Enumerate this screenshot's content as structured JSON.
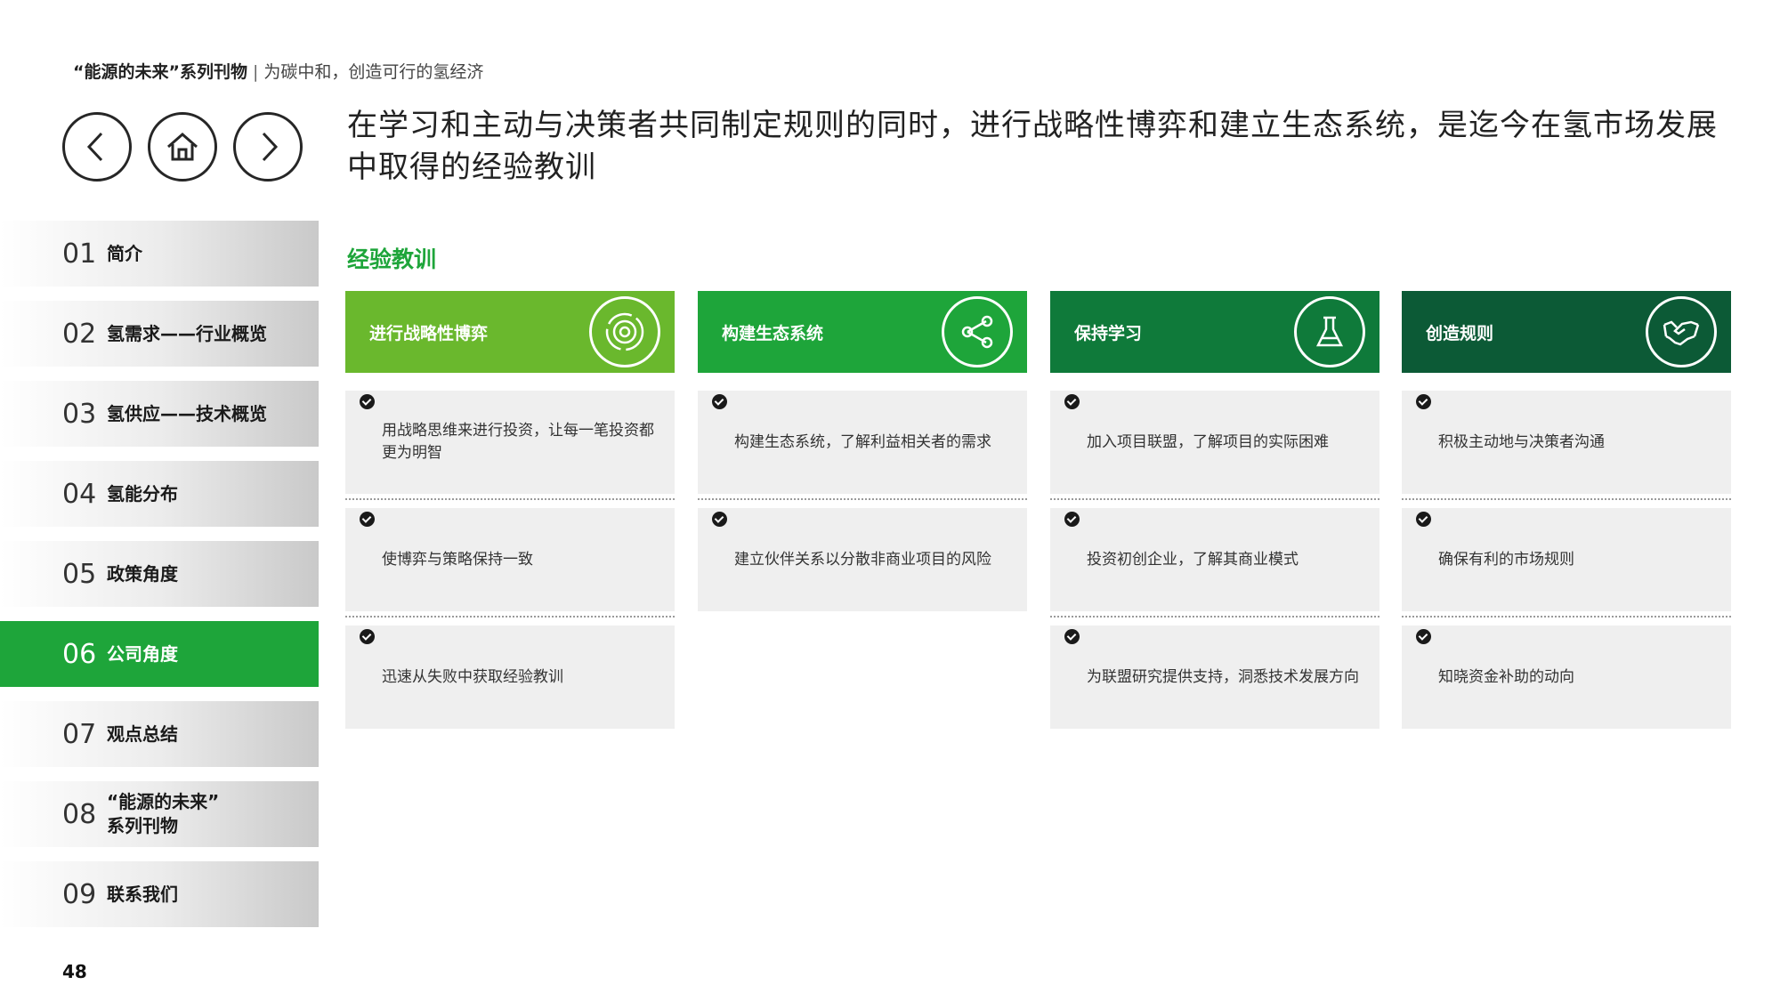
{
  "header": {
    "series": "“能源的未来”系列刊物",
    "separator": "|",
    "subtitle": "为碳中和，创造可行的氢经济"
  },
  "nav": {
    "back_icon": "chevron-left-icon",
    "home_icon": "home-icon",
    "forward_icon": "chevron-right-icon"
  },
  "headline": "在学习和主动与决策者共同制定规则的同时，进行战略性博弈和建立生态系统，是迄今在氢市场发展中取得的经验教训",
  "sidebar": {
    "items": [
      {
        "num": "01",
        "label": "简介"
      },
      {
        "num": "02",
        "label": "氢需求——行业概览"
      },
      {
        "num": "03",
        "label": "氢供应——技术概览"
      },
      {
        "num": "04",
        "label": "氢能分布"
      },
      {
        "num": "05",
        "label": "政策角度"
      },
      {
        "num": "06",
        "label": "公司角度"
      },
      {
        "num": "07",
        "label": "观点总结"
      },
      {
        "num": "08",
        "label_line1": "“能源的未来”",
        "label_line2": "系列刊物"
      },
      {
        "num": "09",
        "label": "联系我们"
      }
    ],
    "active_index": 5
  },
  "section_title": "经验教训",
  "columns": [
    {
      "title": "进行战略性博弈",
      "icon": "target-icon",
      "color": "#6ab82d",
      "items": [
        "用战略思维来进行投资，让每一笔投资都更为明智",
        "使博弈与策略保持一致",
        "迅速从失败中获取经验教训"
      ]
    },
    {
      "title": "构建生态系统",
      "icon": "share-icon",
      "color": "#1ea53a",
      "items": [
        "构建生态系统，了解利益相关者的需求",
        "建立伙伴关系以分散非商业项目的风险"
      ]
    },
    {
      "title": "保持学习",
      "icon": "flask-icon",
      "color": "#0f7a3a",
      "items": [
        "加入项目联盟，了解项目的实际困难",
        "投资初创企业，了解其商业模式",
        "为联盟研究提供支持，洞悉技术发展方向"
      ]
    },
    {
      "title": "创造规则",
      "icon": "handshake-icon",
      "color": "#0c5a36",
      "items": [
        "积极主动地与决策者沟通",
        "确保有利的市场规则",
        "知晓资金补助的动向"
      ]
    }
  ],
  "page_number": "48"
}
